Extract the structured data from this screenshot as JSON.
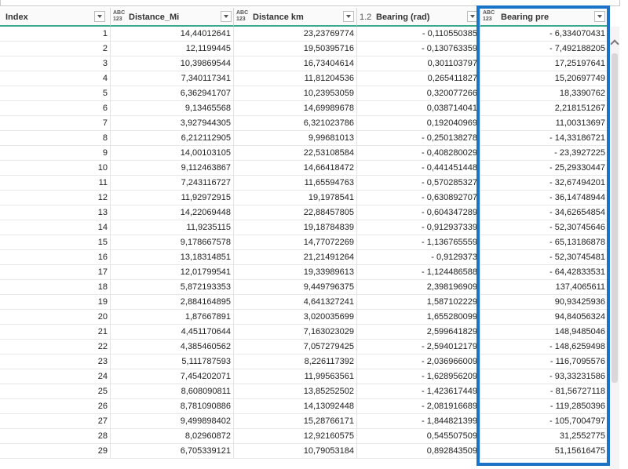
{
  "columns": [
    {
      "type": "",
      "label": "Index"
    },
    {
      "type": "ABC\n123",
      "label": "Distance_Mi"
    },
    {
      "type": "ABC\n123",
      "label": "Distance km"
    },
    {
      "type": "1.2",
      "label": "Bearing (rad)"
    },
    {
      "type": "ABC\n123",
      "label": "Bearing pre"
    }
  ],
  "rows": [
    [
      "1",
      "14,44012641",
      "23,23769774",
      "- 0,110550385",
      "- 6,334070431"
    ],
    [
      "2",
      "12,1199445",
      "19,50395716",
      "- 0,130763359",
      "- 7,492188205"
    ],
    [
      "3",
      "10,39869544",
      "16,73404614",
      "0,301103797",
      "17,25197641"
    ],
    [
      "4",
      "7,340117341",
      "11,81204536",
      "0,265411827",
      "15,20697749"
    ],
    [
      "5",
      "6,362941707",
      "10,23953059",
      "0,320077266",
      "18,3390762"
    ],
    [
      "6",
      "9,13465568",
      "14,69989678",
      "0,038714041",
      "2,218151267"
    ],
    [
      "7",
      "3,927944305",
      "6,321023786",
      "0,192040969",
      "11,00313697"
    ],
    [
      "8",
      "6,212112905",
      "9,99681013",
      "- 0,250138278",
      "- 14,33186721"
    ],
    [
      "9",
      "14,00103105",
      "22,53108584",
      "- 0,408280029",
      "- 23,3927225"
    ],
    [
      "10",
      "9,112463867",
      "14,66418472",
      "- 0,441451448",
      "- 25,29330447"
    ],
    [
      "11",
      "7,243116727",
      "11,65594763",
      "- 0,570285327",
      "- 32,67494201"
    ],
    [
      "12",
      "11,92972915",
      "19,1978541",
      "- 0,630892707",
      "- 36,14748944"
    ],
    [
      "13",
      "14,22069448",
      "22,88457805",
      "- 0,604347289",
      "- 34,62654854"
    ],
    [
      "14",
      "11,9235115",
      "19,18784839",
      "- 0,912937339",
      "- 52,30745646"
    ],
    [
      "15",
      "9,178667578",
      "14,77072269",
      "- 1,136765559",
      "- 65,13186878"
    ],
    [
      "16",
      "13,18314851",
      "21,21491264",
      "- 0,9129373",
      "- 52,30745481"
    ],
    [
      "17",
      "12,01799541",
      "19,33989613",
      "- 1,124486588",
      "- 64,42833531"
    ],
    [
      "18",
      "5,872193353",
      "9,449796375",
      "2,398196909",
      "137,4065611"
    ],
    [
      "19",
      "2,884164895",
      "4,641327241",
      "1,587102229",
      "90,93425936"
    ],
    [
      "20",
      "1,87667891",
      "3,020035699",
      "1,655280099",
      "94,84056324"
    ],
    [
      "21",
      "4,451170644",
      "7,163023029",
      "2,599641829",
      "148,9485046"
    ],
    [
      "22",
      "4,385460562",
      "7,057279425",
      "- 2,594012179",
      "- 148,6259498"
    ],
    [
      "23",
      "5,111787593",
      "8,226117392",
      "- 2,036966009",
      "- 116,7095576"
    ],
    [
      "24",
      "7,454202071",
      "11,99563561",
      "- 1,628956209",
      "- 93,33231586"
    ],
    [
      "25",
      "8,608090811",
      "13,85252502",
      "- 1,423617449",
      "- 81,56727118"
    ],
    [
      "26",
      "8,781090886",
      "14,13092448",
      "- 2,081916689",
      "- 119,2850396"
    ],
    [
      "27",
      "9,499898402",
      "15,28766171",
      "- 1,844821399",
      "- 105,7004797"
    ],
    [
      "28",
      "8,02960872",
      "12,92160575",
      "0,545507509",
      "31,2552775"
    ],
    [
      "29",
      "6,705339121",
      "10,79053184",
      "0,892843509",
      "51,15616475"
    ]
  ]
}
